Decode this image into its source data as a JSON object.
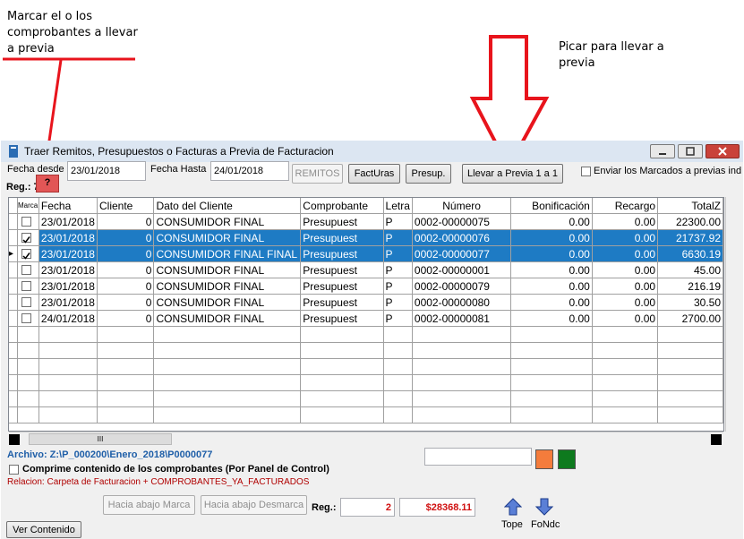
{
  "annotations": {
    "left_note": [
      "Marcar el o los",
      "comprobantes a llevar",
      "a previa"
    ],
    "right_note": [
      "Picar para llevar a",
      "previa"
    ]
  },
  "window": {
    "title": "Traer Remitos, Presupuestos o Facturas a Previa de Facturacion",
    "controls": [
      "—",
      "▭",
      "✕"
    ]
  },
  "filters": {
    "desde_label": "Fecha desde",
    "desde_value": "23/01/2018",
    "hasta_label": "Fecha Hasta",
    "hasta_value": "24/01/2018",
    "remitos_btn": "REMITOS",
    "facturas_btn": "FactUras",
    "presup_btn": "Presup.",
    "llevar_btn": "Llevar a Previa 1 a 1",
    "enviar_label": "Enviar los Marcados a previas ind",
    "reg_label": "Reg.: 7",
    "help_btn": "?"
  },
  "grid": {
    "columns": [
      "Marca",
      "Fecha",
      "Cliente",
      "Dato del Cliente",
      "Comprobante",
      "Letra",
      "Número",
      "Bonificación",
      "Recargo",
      "TotalZ"
    ],
    "rows": [
      {
        "checked": false,
        "selected": false,
        "pointer": "",
        "fecha": "23/01/2018",
        "cliente": "0",
        "dato": "CONSUMIDOR FINAL",
        "comprobante": "Presupuest",
        "letra": "P",
        "numero": "0002-00000075",
        "bonif": "0.00",
        "recargo": "0.00",
        "total": "22300.00"
      },
      {
        "checked": true,
        "selected": true,
        "pointer": "",
        "fecha": "23/01/2018",
        "cliente": "0",
        "dato": "CONSUMIDOR FINAL",
        "comprobante": "Presupuest",
        "letra": "P",
        "numero": "0002-00000076",
        "bonif": "0.00",
        "recargo": "0.00",
        "total": "21737.92"
      },
      {
        "checked": true,
        "selected": true,
        "pointer": "▸",
        "fecha": "23/01/2018",
        "cliente": "0",
        "dato": "CONSUMIDOR FINAL FINAL",
        "comprobante": "Presupuest",
        "letra": "P",
        "numero": "0002-00000077",
        "bonif": "0.00",
        "recargo": "0.00",
        "total": "6630.19"
      },
      {
        "checked": false,
        "selected": false,
        "pointer": "",
        "fecha": "23/01/2018",
        "cliente": "0",
        "dato": "CONSUMIDOR FINAL",
        "comprobante": "Presupuest",
        "letra": "P",
        "numero": "0002-00000001",
        "bonif": "0.00",
        "recargo": "0.00",
        "total": "45.00"
      },
      {
        "checked": false,
        "selected": false,
        "pointer": "",
        "fecha": "23/01/2018",
        "cliente": "0",
        "dato": "CONSUMIDOR FINAL",
        "comprobante": "Presupuest",
        "letra": "P",
        "numero": "0002-00000079",
        "bonif": "0.00",
        "recargo": "0.00",
        "total": "216.19"
      },
      {
        "checked": false,
        "selected": false,
        "pointer": "",
        "fecha": "23/01/2018",
        "cliente": "0",
        "dato": "CONSUMIDOR FINAL",
        "comprobante": "Presupuest",
        "letra": "P",
        "numero": "0002-00000080",
        "bonif": "0.00",
        "recargo": "0.00",
        "total": "30.50"
      },
      {
        "checked": false,
        "selected": false,
        "pointer": "",
        "fecha": "24/01/2018",
        "cliente": "0",
        "dato": "CONSUMIDOR FINAL",
        "comprobante": "Presupuest",
        "letra": "P",
        "numero": "0002-00000081",
        "bonif": "0.00",
        "recargo": "0.00",
        "total": "2700.00"
      }
    ],
    "empty_rows": 6,
    "hscroll_grip": "III"
  },
  "footer": {
    "archivo": "Archivo: Z:\\P_000200\\Enero_2018\\P0000077",
    "comprime_label": "Comprime contenido de los comprobantes (Por Panel de Control)",
    "relacion": "Relacion: Carpeta de Facturacion + COMPROBANTES_YA_FACTURADOS",
    "hacia_abajo_marca": "Hacia abajo Marca",
    "hacia_abajo_desmarca": "Hacia abajo Desmarca",
    "reg_label": "Reg.:",
    "reg_value": "2",
    "total_value": "$28368.11",
    "tope_label": "Tope",
    "fondo_label": "FoNdc",
    "ver_contenido": "Ver Contenido"
  },
  "colors": {
    "selection": "#1e7bc4",
    "annotation_red": "#e8141c",
    "orange_swatch": "#f47c3c",
    "green_swatch": "#0e7a1e",
    "archivo_blue": "#1f5fa8",
    "relacion_red": "#b00000"
  }
}
